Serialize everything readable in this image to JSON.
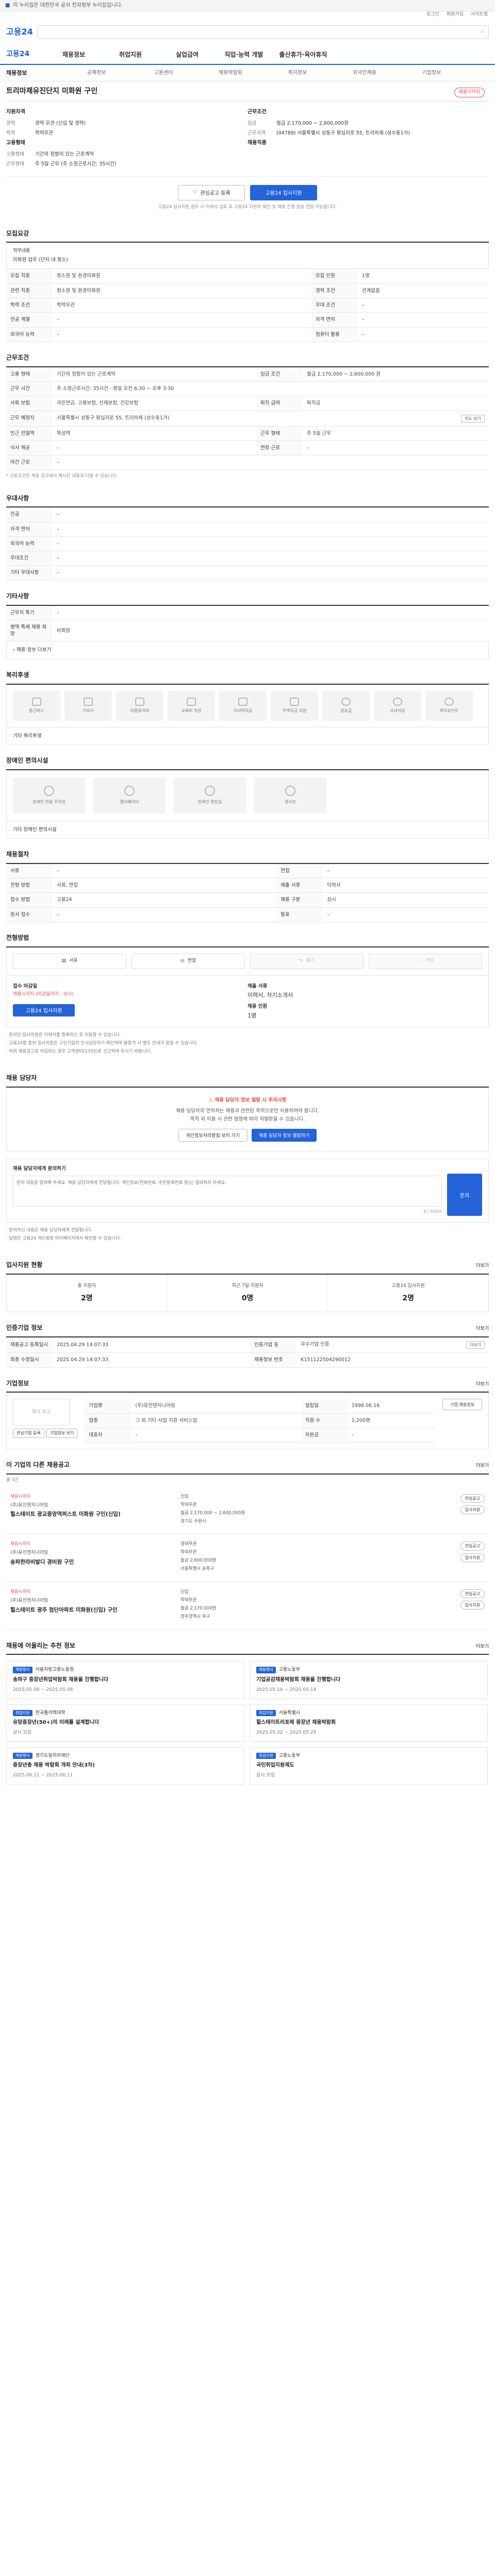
{
  "topbar": {
    "notice": "이 누리집은 대한민국 공식 전자정부 누리집입니다."
  },
  "header": {
    "logo": "고용24",
    "search_placeholder": "",
    "search_icon": "search-icon",
    "util": [
      "로그인",
      "회원가입",
      "사이트맵"
    ]
  },
  "gnb": {
    "brand": "고용24",
    "items": [
      "채용정보",
      "취업지원",
      "실업급여",
      "직업·능력 개발",
      "출산휴가·육아휴직"
    ]
  },
  "subtabs": {
    "title": "채용정보",
    "items": [
      "공채정보",
      "고용센터",
      "채용박람회",
      "복지정보",
      "외국인채용",
      "기업정보"
    ]
  },
  "job": {
    "title": "트리마제유진단지 미화원 구인",
    "badge": "채용시까지"
  },
  "summary": {
    "left": {
      "heading": "지원자격",
      "rows": [
        {
          "k": "경력",
          "v": "경력 무관 (신입 및 경력)"
        },
        {
          "k": "학력",
          "v": "학력무관"
        }
      ],
      "heading2": "고용형태",
      "rows2": [
        {
          "k": "고용형태",
          "v": "기간의 정함이 있는 근로계약"
        },
        {
          "k": "근무형태",
          "v": "주 5일 근무 (주 소정근로시간: 35시간)"
        }
      ]
    },
    "right": {
      "heading": "근무조건",
      "rows": [
        {
          "k": "임금",
          "v": "월급 2,170,000 ~ 2,600,000원"
        },
        {
          "k": "근무지역",
          "v": "(04789) 서울특별시 성동구 왕십리로 55, 트리마제 (성수동1가)"
        }
      ],
      "heading2": "채용직종",
      "rows2": [
        {
          "k": "",
          "v": ""
        }
      ]
    }
  },
  "actions": {
    "like": "관심공고 등록",
    "apply": "고용24 입사지원",
    "note": "고용24 입사지원 접수 시 이력서 검토 후 고용24 지원자 확인 및 채용 진행 알림 전달 가능합니다."
  },
  "recruit": {
    "title": "모집요강",
    "work_label": "직무내용",
    "work_text": "미화원 업무 (단지 내 청소)",
    "rows": [
      {
        "k": "모집 직종",
        "v": "청소원 및 환경미화원"
      },
      {
        "k": "모집 인원",
        "v": "1명"
      },
      {
        "k": "관련 직종",
        "v": "청소원 및 환경미화원"
      },
      {
        "k": "경력 조건",
        "v": "관계없음"
      },
      {
        "k": "학력 조건",
        "v": "학력무관"
      },
      {
        "k": "우대 조건",
        "v": "–"
      },
      {
        "k": "전공 계열",
        "v": "–"
      },
      {
        "k": "자격 면허",
        "v": "–"
      },
      {
        "k": "외국어 능력",
        "v": "–"
      },
      {
        "k": "컴퓨터 활용",
        "v": "–"
      }
    ]
  },
  "work": {
    "title": "근무조건",
    "rows": [
      {
        "k": "고용 형태",
        "v": "기간의 정함이 있는 근로계약"
      },
      {
        "k": "임금 조건",
        "v": "월급 2,170,000 ~ 2,600,000 원"
      },
      {
        "k": "근무 시간",
        "v": "주 소정근로시간: 35시간 · 평일 오전 6:30 ~ 오후 3:30"
      },
      {
        "k": "사회 보험",
        "v": "국민연금, 고용보험, 산재보험, 건강보험"
      },
      {
        "k": "퇴직 급여",
        "v": "퇴직금"
      },
      {
        "k": "근무 예정지",
        "v": "서울특별시 성동구 왕십리로 55, 트리마제 (성수동1가)"
      },
      {
        "k": "인근 전철역",
        "v": "뚝섬역"
      },
      {
        "k": "근무 형태",
        "v": "주 5일 근무"
      },
      {
        "k": "식사 제공",
        "v": "–"
      },
      {
        "k": "연장 근로",
        "v": "–"
      },
      {
        "k": "야간 근로",
        "v": "–"
      }
    ],
    "map_button": "지도 보기",
    "footnote": "* 근로조건은 채용 공고에서 제시된 내용과 다를 수 있습니다."
  },
  "preference": {
    "title": "우대사항",
    "rows": [
      {
        "k": "전공",
        "v": "–"
      },
      {
        "k": "자격 면허",
        "v": "–"
      },
      {
        "k": "외국어 능력",
        "v": "–"
      },
      {
        "k": "우대조건",
        "v": "–"
      },
      {
        "k": "기타 우대사항",
        "v": "–"
      }
    ]
  },
  "others": {
    "title": "기타사항",
    "rows": [
      {
        "k": "근무지 특기",
        "v": "–"
      },
      {
        "k": "병역 특례 채용 희망",
        "v": "비희망"
      }
    ],
    "more": "채용 정보 더보기"
  },
  "welfare": {
    "title": "복리후생",
    "items": [
      "통근버스",
      "기숙사",
      "차량유지비",
      "교육비 지원",
      "자녀학자금",
      "주택자금 지원",
      "경조금",
      "사내식당",
      "복지포인트"
    ],
    "etc_label": "기타 복리후생"
  },
  "disability": {
    "title": "장애인 편의시설",
    "items": [
      "장애인 전용 주차장",
      "엘리베이터",
      "장애인 화장실",
      "경사로"
    ],
    "etc_label": "기타 장애인 편의시설"
  },
  "process": {
    "title": "채용절차",
    "rows": [
      {
        "k": "서류",
        "v": "–",
        "k2": "면접",
        "v2": "–"
      },
      {
        "k": "전형 방법",
        "v": "서류, 면접",
        "k2": "제출 서류",
        "v2": "이력서"
      },
      {
        "k": "접수 방법",
        "v": "고용24",
        "k2": "채용 구분",
        "v2": "상시"
      },
      {
        "k": "원서 접수",
        "v": "–",
        "k2": "발표",
        "v2": "–"
      }
    ]
  },
  "method": {
    "title": "전형방법",
    "items": [
      "서류",
      "면접",
      "필기",
      "기타"
    ],
    "apply_label": "접수 마감일",
    "apply_value": "채용시까지 (마감일까지 : 상시)",
    "doc_label": "제출 서류",
    "doc_value": "이력서, 자기소개서",
    "doc_label2": "채용 인원",
    "doc_value2": "1명",
    "apply_btn": "고용24 입사지원",
    "notices": [
      "· 온라인 입사지원은 이력서를 등록하신 후 이용할 수 있습니다.",
      "· 고용24를 통한 입사지원은 구인기업의 인사담당자가 확인하며 불합격 시 별도 안내가 없을 수 있습니다.",
      "· 허위 채용공고로 의심되는 경우 고객센터(1350)로 신고하여 주시기 바랍니다."
    ]
  },
  "contact": {
    "title": "채용 담당자",
    "warn": "채용 담당자 정보 열람 시 주의사항",
    "desc1": "채용 담당자의 연락처는 채용과 관련된 목적으로만 이용하여야 합니다.",
    "desc2": "목적 외 이용 시 관련 법령에 따라 처벌받을 수 있습니다.",
    "btn_out": "개인정보처리방침 보러 가기",
    "btn_pri": "채용 담당자 정보 열람하기",
    "ask_title": "채용 담당자에게 문의하기",
    "ask_placeholder": "문의 내용을 입력해 주세요. 채용 담당자에게 전달됩니다. 개인정보(전화번호, 주민등록번호 등)는 입력하지 마세요.",
    "ask_count": "0 / 500자",
    "ask_btn": "문의",
    "ask_notes": [
      "· 문의하신 내용은 채용 담당자에게 전달됩니다.",
      "· 답변은 고용24 개인회원 마이페이지에서 확인할 수 있습니다."
    ]
  },
  "stats": {
    "title": "입사지원 현황",
    "more": "더보기",
    "items": [
      {
        "t": "총 지원자",
        "n": "2명"
      },
      {
        "t": "최근 7일 지원자",
        "n": "0명"
      },
      {
        "t": "고용24 입사지원",
        "n": "2명"
      }
    ]
  },
  "manage": {
    "title": "인증기업 정보",
    "more": "더보기",
    "rows": [
      {
        "k": "채용공고 등록일시",
        "v": "2025.04.29 14:07:33",
        "k2": "인증기업 등",
        "v2": "우수기업 인증",
        "k3": "",
        "v3": ""
      },
      {
        "k": "최종 수정일시",
        "v": "2025.04.29 14:07:33",
        "k2": "채용정보 번호",
        "v2": "K151122504290012",
        "k3": "",
        "v3": ""
      }
    ],
    "more_btn": "더보기"
  },
  "company": {
    "title": "기업정보",
    "more": "더보기",
    "logo": "회사 로고",
    "rows": [
      {
        "k": "기업명",
        "v": "(주)유진엔지니어링",
        "k2": "설립일",
        "v2": "1998.06.16"
      },
      {
        "k": "업종",
        "v": "그 외 기타 사업 지원 서비스업",
        "k2": "직원 수",
        "v2": "1,200명"
      },
      {
        "k": "대표자",
        "v": "–",
        "k2": "자본금",
        "v2": "–"
      }
    ],
    "btn1": "관심기업 등록",
    "btn2": "기업정보 보기",
    "company_btn": "기업 채용정보"
  },
  "jobs": {
    "title": "이 기업의 다른 채용공고",
    "sub": "총 3건",
    "more": "더보기",
    "items": [
      {
        "badge": "채용시까지",
        "org": "(주)유진엔지니어링",
        "title": "힐스테이트 광교중앙역퍼스트 미화원 구인(신입)",
        "m1": "신입",
        "m2": "학력무관",
        "m3": "월급 2,170,000 ~ 2,600,000원",
        "m4": "경기도 수원시",
        "p1": "관심공고",
        "p2": "입사지원"
      },
      {
        "badge": "채용시까지",
        "org": "(주)유진엔지니어링",
        "title": "송파한라비발디 경비원 구인",
        "m1": "경력무관",
        "m2": "학력무관",
        "m3": "월급 2,600,000원",
        "m4": "서울특별시 송파구",
        "p1": "관심공고",
        "p2": "입사지원"
      },
      {
        "badge": "채용시까지",
        "org": "(주)유진엔지니어링",
        "title": "힐스테이트 광주 첨단아파트 미화원(신입) 구인",
        "m1": "신입",
        "m2": "학력무관",
        "m3": "월급 2,170,000원",
        "m4": "광주광역시 북구",
        "p1": "관심공고",
        "p2": "입사지원"
      }
    ]
  },
  "policy": {
    "title": "채용에 어울리는 추천 정보",
    "more": "더보기",
    "items": [
      {
        "tag": "채용행사",
        "org": "서울지방고용노동청",
        "title": "송파구 중장년취업박람회 채용을 진행합니다",
        "s": "2025.05.08 ~ 2025.05.08"
      },
      {
        "tag": "채용행사",
        "org": "고용노동부",
        "title": "기업공감채용박람회 채용을 진행합니다",
        "s": "2025.05.14 ~ 2025.05.14"
      },
      {
        "tag": "취업지원",
        "org": "한국폴리텍대학",
        "title": "유망중장년(50+)의 미래를 설계합니다",
        "s": "상시 모집"
      },
      {
        "tag": "취업지원",
        "org": "서울특별시",
        "title": "힐스테이트리포레 중장년 채용박람회",
        "s": "2025.05.22 ~ 2025.05.29"
      },
      {
        "tag": "채용행사",
        "org": "경기도일자리재단",
        "title": "중장년층 채용 박람회 개최 안내(3차)",
        "s": "2025.06.11 ~ 2025.06.11"
      },
      {
        "tag": "취업지원",
        "org": "고용노동부",
        "title": "국민취업지원제도",
        "s": "상시 모집"
      }
    ]
  }
}
